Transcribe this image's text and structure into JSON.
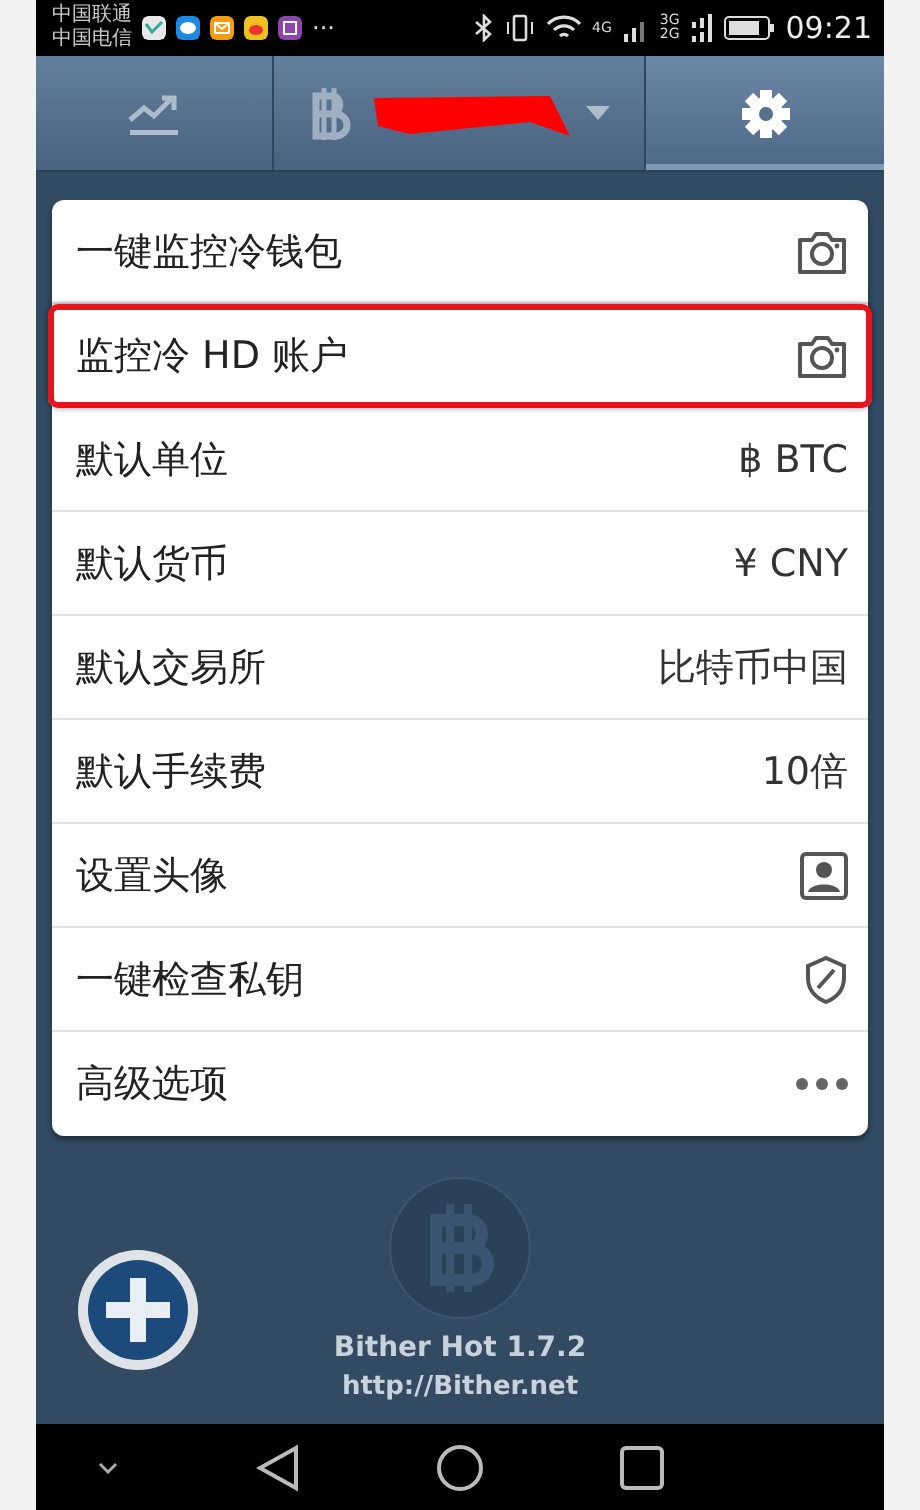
{
  "status_bar": {
    "carriers": [
      "中国联通",
      "中国电信"
    ],
    "more": "···",
    "network_4g": "4G",
    "network_3g": "3G",
    "network_2g": "2G",
    "time": "09:21"
  },
  "top_nav": {
    "tabs": [
      {
        "kind": "chart",
        "selected": false
      },
      {
        "kind": "account",
        "selected": false
      },
      {
        "kind": "settings",
        "selected": true
      }
    ]
  },
  "settings": [
    {
      "label": "一键监控冷钱包",
      "kind": "camera",
      "highlighted": false
    },
    {
      "label": "监控冷 HD 账户",
      "kind": "camera",
      "highlighted": true
    },
    {
      "label": "默认单位",
      "kind": "value",
      "value": "฿ BTC",
      "highlighted": false
    },
    {
      "label": "默认货币",
      "kind": "value",
      "value": "¥ CNY",
      "highlighted": false
    },
    {
      "label": "默认交易所",
      "kind": "value",
      "value": "比特币中国",
      "highlighted": false
    },
    {
      "label": "默认手续费",
      "kind": "value",
      "value": "10倍",
      "highlighted": false
    },
    {
      "label": "设置头像",
      "kind": "portrait",
      "highlighted": false
    },
    {
      "label": "一键检查私钥",
      "kind": "shield",
      "highlighted": false
    },
    {
      "label": "高级选项",
      "kind": "more",
      "highlighted": false
    }
  ],
  "footer": {
    "app_version": "Bither Hot 1.7.2",
    "website": "http://Bither.net"
  }
}
